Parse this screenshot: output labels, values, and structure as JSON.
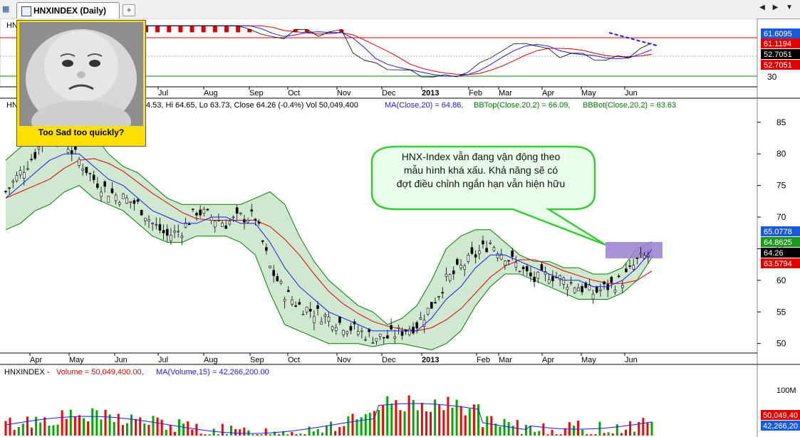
{
  "window": {
    "tab_title": "HNXINDEX (Daily)",
    "close_glyph": "✕",
    "add_glyph": "+",
    "nav_glyph": "◀ ▶ ▼"
  },
  "callout": {
    "line1": "HNX-Index vẫn đang vận động theo",
    "line2": "mẫu hình khá xấu. Khả năng sẽ có",
    "line3": "đợt điều chỉnh ngắn hạn vẫn hiện hữu"
  },
  "image_caption": "Too Sad too quickly?",
  "colors": {
    "price_up": "#000000",
    "ma20": "#1a1aff",
    "bb_top": "#008000",
    "bb_bot": "#008000",
    "bb_fill": "#cfe8cf",
    "ma_red": "#e00000",
    "vol_red": "#ff0000",
    "vol_green": "#00aa00",
    "vol_ma": "#1a1aff",
    "highlight": "#9a7fd0",
    "callout_fill": "#eaffea",
    "callout_border": "#33cc33"
  },
  "chart_data": [
    {
      "type": "line",
      "name": "upper-oscillator",
      "prefix_label": "HN",
      "x_tick_labels": [
        "Jul",
        "Aug",
        "Sep",
        "Oct",
        "Nov",
        "Dec",
        "2013",
        "Feb",
        "Mar",
        "Apr",
        "May",
        "Jun"
      ],
      "y_tick_labels": [
        "30"
      ],
      "value_tags": [
        {
          "text": "61.6095",
          "bg": "#1a5ad8",
          "fg": "#ffffff"
        },
        {
          "text": "61.1194",
          "bg": "#e00000",
          "fg": "#ffffff"
        },
        {
          "text": "52.7051",
          "bg": "#000000",
          "fg": "#ffffff"
        },
        {
          "text": "52.7051",
          "bg": "#e00000",
          "fg": "#ffffff"
        }
      ],
      "level_upper": 61.6,
      "level_lower": 30
    },
    {
      "type": "candlestick",
      "name": "price",
      "legend": {
        "prefix": "HN",
        "ohlc_text": "4.53, Hi 64.65, Lo 63.73, Close 64.26 (-0.4%) Vol 50,049,400",
        "ma_text": "MA(Close,20) = 64.86,",
        "bbtop_text": "BBTop(Close,20,2) = 66.09,",
        "bbbot_text": "BBBot(Close,20,2) = 63.63"
      },
      "x_tick_labels": [
        "Apr",
        "May",
        "Jun",
        "Jul",
        "Aug",
        "Sep",
        "Oct",
        "Nov",
        "Dec",
        "2013",
        "Feb",
        "Mar",
        "Apr",
        "May",
        "Jun"
      ],
      "y_ticks": [
        50,
        55,
        60,
        65,
        70,
        75,
        80,
        85
      ],
      "ylim": [
        48.5,
        87
      ],
      "close_series": [
        74,
        77,
        80,
        84,
        82,
        79,
        76,
        74,
        73,
        72,
        69,
        67,
        68,
        71,
        70,
        69,
        70,
        70,
        62,
        58,
        56,
        55,
        54,
        53,
        52,
        51,
        51,
        52,
        53,
        56,
        60,
        62,
        64,
        66,
        64,
        62,
        60,
        61,
        60,
        59,
        58,
        59,
        60,
        63,
        64.3
      ],
      "ma20": [
        73,
        75,
        77,
        79,
        80,
        80,
        78,
        76,
        75,
        73,
        71,
        70,
        69,
        69,
        70,
        70,
        69,
        69,
        66,
        62,
        59,
        57,
        55,
        54,
        53,
        52,
        52,
        52,
        52,
        54,
        57,
        59,
        62,
        64,
        64,
        63,
        62,
        61,
        60,
        60,
        59,
        59,
        60,
        62,
        64.86
      ],
      "bb_top": [
        79,
        81,
        83,
        86,
        86,
        85,
        83,
        80,
        78,
        77,
        75,
        73,
        72,
        72,
        72,
        72,
        72,
        73,
        74,
        72,
        67,
        63,
        60,
        58,
        56,
        55,
        53,
        54,
        56,
        60,
        65,
        67,
        68,
        68,
        66,
        64,
        63,
        63,
        62,
        62,
        61,
        61,
        62,
        65,
        66.09
      ],
      "bb_bot": [
        68,
        69,
        71,
        72,
        74,
        75,
        73,
        72,
        71,
        69,
        67,
        66,
        66,
        67,
        67,
        67,
        66,
        64,
        58,
        53,
        52,
        51,
        50,
        50,
        50,
        49.5,
        50,
        50,
        49.5,
        49,
        50,
        52,
        56,
        59,
        61,
        61,
        60,
        59,
        58,
        57,
        57,
        57,
        58,
        60,
        63.63
      ],
      "value_tags": [
        {
          "text": "65.0778",
          "bg": "#1a5ad8",
          "fg": "#ffffff"
        },
        {
          "text": "64.8625",
          "bg": "#1a9a1a",
          "fg": "#ffffff"
        },
        {
          "text": "64.26",
          "bg": "#000000",
          "fg": "#ffffff"
        },
        {
          "text": "63.5794",
          "bg": "#e00000",
          "fg": "#ffffff"
        }
      ]
    },
    {
      "type": "bar",
      "name": "volume",
      "legend": {
        "prefix": "HNXINDEX - ",
        "vol_text": "Volume = 50,049,400.00,",
        "ma_text": "MA(Volume,15) = 42,266,200.00"
      },
      "y_tick_labels": [
        "100M"
      ],
      "value_tags": [
        {
          "text": "50,049,40",
          "bg": "#e00000",
          "fg": "#ffffff"
        },
        {
          "text": "42,266,20",
          "bg": "#1a5ad8",
          "fg": "#ffffff"
        }
      ],
      "last_volume": 50049400,
      "last_ma15": 42266200
    }
  ]
}
